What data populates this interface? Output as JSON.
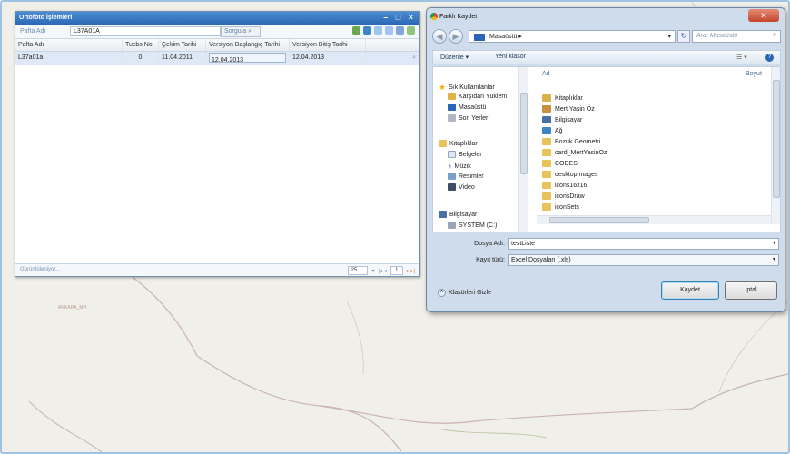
{
  "map": {
    "place_label": "ANKARA_MH"
  },
  "ortofoto": {
    "title": "Ortofoto İşlemleri",
    "window_buttons": "– □ ×",
    "filter_label": "Pafta Adı",
    "filter_value": "L37A01A",
    "search_label": "Sorgula",
    "columns": [
      "Pafta Adı",
      "Tucbs No",
      "Çekim Tarihi",
      "Versiyon Başlangıç Tarihi",
      "Versiyon Bitiş Tarihi"
    ],
    "rows": [
      [
        "L37a01a",
        "0",
        "11.04.2011",
        "12.04.2013",
        "12.04.2013"
      ]
    ],
    "status": "Görüntüleniyor...",
    "page_size": "25",
    "page_number": "1",
    "pager_prev": "|◂ ◂",
    "pager_next": "▸ ▸|"
  },
  "dialog": {
    "title": "Farklı Kaydet",
    "close": "✕",
    "address": "Masaüstü ▸",
    "search_placeholder": "Ara: Masaüstü",
    "organize": "Düzenle ▾",
    "new_folder": "Yeni klasör",
    "nav": {
      "favorites": "Sık Kullanılanlar",
      "downloads": "Karşıdan Yüklem",
      "desktop": "Masaüstü",
      "recent": "Son Yerler",
      "libraries": "Kitaplıklar",
      "documents": "Belgeler",
      "music": "Müzik",
      "pictures": "Resimler",
      "video": "Video",
      "computer": "Bilgisayar",
      "system": "SYSTEM (C:)"
    },
    "col_name": "Ad",
    "col_size": "Boyut",
    "files": [
      "Kitaplıklar",
      "Mert Yasin Öz",
      "Bilgisayar",
      "Ağ",
      "Bozuk Geometri",
      "card_MertYasinOz",
      "CODES",
      "desktopImages",
      "icons16x16",
      "iconsDraw",
      "iconSets"
    ],
    "filename_label": "Dosya Adı:",
    "filename": "testListe",
    "filetype_label": "Kayıt türü:",
    "filetype": "Excel Dosyaları (.xls)",
    "hide_folders": "Klasörleri Gizle",
    "save": "Kaydet",
    "cancel": "İptal"
  }
}
